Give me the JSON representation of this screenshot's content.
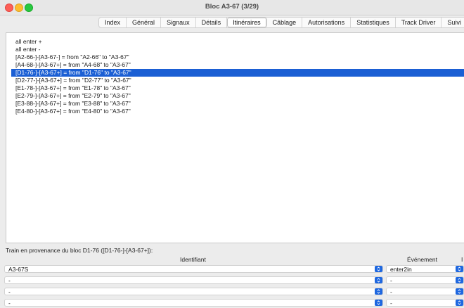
{
  "window": {
    "title": "Bloc A3-67 (3/29)"
  },
  "tabs": [
    {
      "label": "Index",
      "active": false
    },
    {
      "label": "Général",
      "active": false
    },
    {
      "label": "Signaux",
      "active": false
    },
    {
      "label": "Détails",
      "active": false
    },
    {
      "label": "Itinéraires",
      "active": true
    },
    {
      "label": "Câblage",
      "active": false
    },
    {
      "label": "Autorisations",
      "active": false
    },
    {
      "label": "Statistiques",
      "active": false
    },
    {
      "label": "Track Driver",
      "active": false
    },
    {
      "label": "Suivi",
      "active": false
    }
  ],
  "routes": [
    {
      "text": "all enter +",
      "selected": false
    },
    {
      "text": "all enter -",
      "selected": false
    },
    {
      "text": "[A2-66-]-[A3-67-] = from \"A2-66\" to \"A3-67\"",
      "selected": false
    },
    {
      "text": "[A4-68-]-[A3-67+] = from \"A4-68\" to \"A3-67\"",
      "selected": false
    },
    {
      "text": "[D1-76-]-[A3-67+] = from \"D1-76\" to \"A3-67\"",
      "selected": true
    },
    {
      "text": "[D2-77-]-[A3-67+] = from \"D2-77\" to \"A3-67\"",
      "selected": false
    },
    {
      "text": "[E1-78-]-[A3-67+] = from \"E1-78\" to \"A3-67\"",
      "selected": false
    },
    {
      "text": "[E2-79-]-[A3-67+] = from \"E2-79\" to \"A3-67\"",
      "selected": false
    },
    {
      "text": "[E3-88-]-[A3-67+] = from \"E3-88\" to \"A3-67\"",
      "selected": false
    },
    {
      "text": "[E4-80-]-[A3-67+] = from \"E4-80\" to \"A3-67\"",
      "selected": false
    }
  ],
  "provenance": {
    "label": "Train en provenance du bloc D1-76 ([D1-76-]-[A3-67+]):",
    "col_identifiant": "Identifiant",
    "col_evenement": "Événement",
    "col_extra": "I",
    "rows": [
      {
        "identifiant": "A3-67S",
        "evenement": "enter2in"
      },
      {
        "identifiant": "-",
        "evenement": "-"
      },
      {
        "identifiant": "-",
        "evenement": "-"
      },
      {
        "identifiant": "-",
        "evenement": "-"
      }
    ]
  },
  "colors": {
    "accent": "#1e67e0",
    "selection": "#1b5fd4"
  },
  "icons": {
    "dropdown": "chevron-updown-icon"
  }
}
